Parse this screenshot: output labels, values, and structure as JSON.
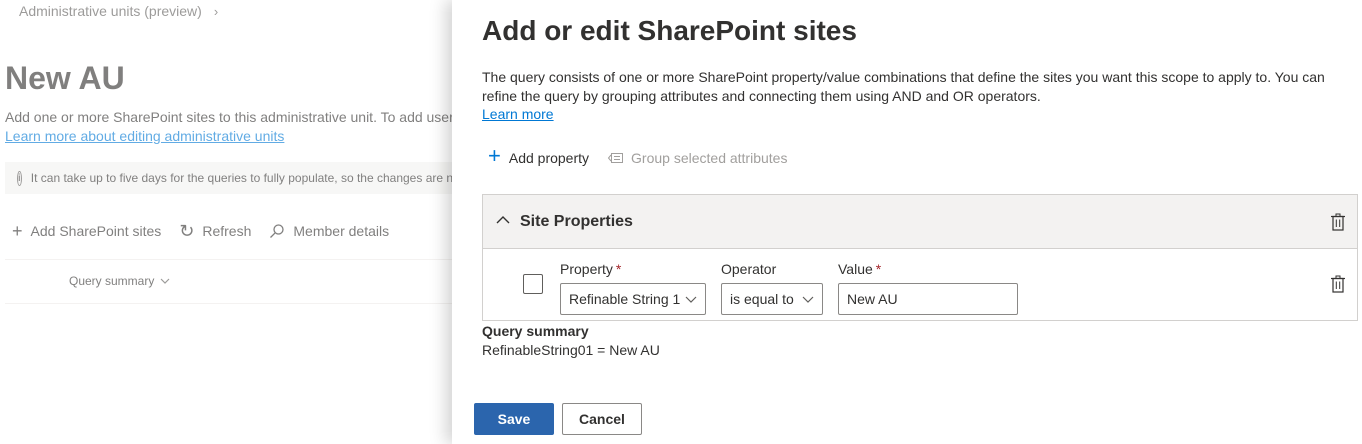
{
  "background": {
    "breadcrumb": "Administrative units (preview)",
    "title": "New AU",
    "description": "Add one or more SharePoint sites to this administrative unit. To add users, groups, or devices, use the administrative unit settings.",
    "learn_link": "Learn more about editing administrative units",
    "info_text": "It can take up to five days for the queries to fully populate, so the changes are not immediately reflected.",
    "commands": {
      "add": "Add SharePoint sites",
      "refresh": "Refresh",
      "member_details": "Member details"
    },
    "column_header": "Query summary"
  },
  "panel": {
    "title": "Add or edit SharePoint sites",
    "description": "The query consists of one or more SharePoint property/value combinations that define the sites you want this scope to apply to. You can refine the query by grouping attributes and connecting them using AND and OR operators.",
    "learn_more": "Learn more",
    "commands": {
      "add_property": "Add property",
      "group": "Group selected attributes"
    },
    "section_title": "Site Properties",
    "row": {
      "property_label": "Property",
      "property_value": "Refinable String 1",
      "operator_label": "Operator",
      "operator_value": "is equal to",
      "value_label": "Value",
      "value_value": "New AU",
      "required_mark": "*"
    },
    "query_summary_label": "Query summary",
    "query_summary_value": "RefinableString01 = New AU",
    "save_label": "Save",
    "cancel_label": "Cancel"
  },
  "colors": {
    "accent": "#0078d4",
    "primary_button": "#2b65ad",
    "required": "#a4262c"
  }
}
